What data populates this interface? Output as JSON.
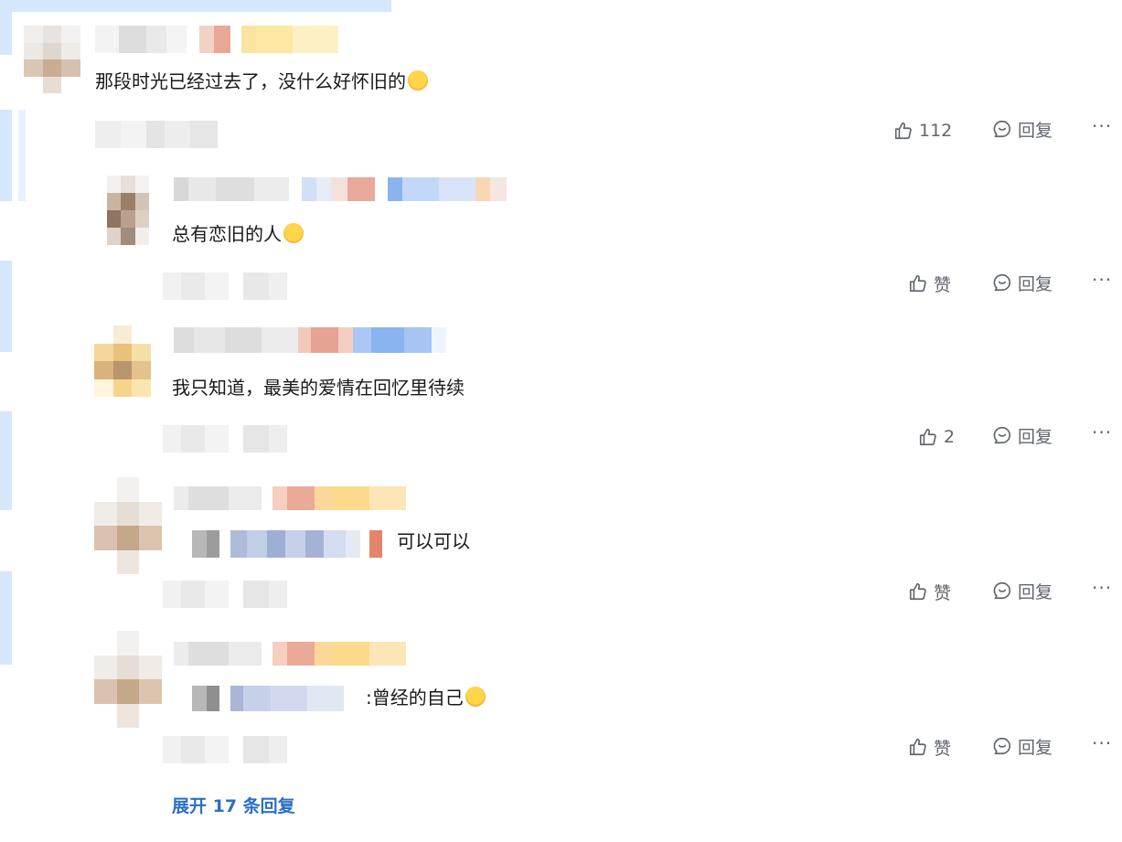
{
  "comments": [
    {
      "text": "那段时光已经过去了，没什么好怀旧的",
      "emoji": "yum-face-icon",
      "likes": "112",
      "reply_label": "回复"
    },
    {
      "text": "总有恋旧的人",
      "emoji": "yum-face-icon",
      "likes": "赞",
      "reply_label": "回复"
    },
    {
      "text": "我只知道，最美的爱情在回忆里待续",
      "likes": "2",
      "reply_label": "回复"
    },
    {
      "text": "可以可以",
      "likes": "赞",
      "reply_label": "回复"
    },
    {
      "text": ":曾经的自己",
      "emoji": "crying-face-icon",
      "likes": "赞",
      "reply_label": "回复"
    }
  ],
  "more_label": "···",
  "expand_label": "展开 17 条回复",
  "colors": {
    "accent_blue": "#2c6fc4",
    "strip_blue": "#d6e6fb",
    "text_gray": "#61666d"
  }
}
